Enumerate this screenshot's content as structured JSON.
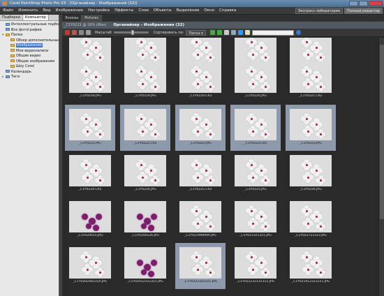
{
  "window": {
    "title": "Corel PaintShop Photo Pro X3 - [Органайзер - Изображения (32)]"
  },
  "menu": [
    "Файл",
    "Изменить",
    "Вид",
    "Изображение",
    "Настройка",
    "Эффекты",
    "Слои",
    "Объекты",
    "Выделение",
    "Окно",
    "Справка"
  ],
  "mode_buttons": [
    "Экспресс-лаборатория",
    "Полный редактор"
  ],
  "left_panel": {
    "tabs": [
      "Подборки",
      "Компьютер"
    ],
    "tree": [
      {
        "label": "Интеллектуальные подборки",
        "expander": "",
        "folder": false
      },
      {
        "label": "Все фотографии",
        "expander": "",
        "folder": false
      },
      {
        "label": "Папки",
        "expander": "▾",
        "folder": true
      },
      {
        "label": "Обзор дополнительных папок",
        "expander": "",
        "folder": true
      },
      {
        "label": "Изображения",
        "expander": "",
        "folder": true,
        "selected": true
      },
      {
        "label": "Мои видеозаписи",
        "expander": "",
        "folder": true
      },
      {
        "label": "Общие видео",
        "expander": "",
        "folder": true
      },
      {
        "label": "Общие изображения",
        "expander": "",
        "folder": true
      },
      {
        "label": "Шоу Corel",
        "expander": "",
        "folder": true
      },
      {
        "label": "Календарь",
        "expander": "",
        "folder": false
      },
      {
        "label": "Теги",
        "expander": "▸",
        "folder": false
      }
    ]
  },
  "file_tabs": [
    "Эскизы",
    "Pictures"
  ],
  "organizer": {
    "file_label": "_C1Y0221 @ 16% (Фон)",
    "title": "Органайзер - Изображения (32)"
  },
  "toolbar": {
    "zoom_label": "Масштаб",
    "zoom_level": 0.55,
    "sort_label": "Сортировать по:",
    "sort_value": "Папка"
  },
  "thumbnails": [
    {
      "caption": "_C1Y0201.JPG",
      "style": "dark",
      "selected": false
    },
    {
      "caption": "_C1Y0216.CR2",
      "style": "dark",
      "selected": false
    },
    {
      "caption": "_C1Y0216.JPG",
      "style": "dark",
      "selected": false
    },
    {
      "caption": "_C1Y0217.CR2",
      "style": "dark",
      "selected": false
    },
    {
      "caption": "_C1Y0217.JPG",
      "style": "dark",
      "selected": false
    },
    {
      "caption": "_C1Y0218.JPG",
      "style": "dark",
      "selected": false
    },
    {
      "caption": "_C1Y0219.JPG",
      "style": "dark",
      "selected": false
    },
    {
      "caption": "_C1Y0220.CR2",
      "style": "dark",
      "selected": false
    },
    {
      "caption": "_C1Y0220.JPG",
      "style": "dark",
      "selected": false
    },
    {
      "caption": "_C1Y0221.CR2",
      "style": "light",
      "selected": false
    },
    {
      "caption": "_C1Y0221.JPG",
      "style": "light",
      "selected": true
    },
    {
      "caption": "_C1Y0222.CR2",
      "style": "light",
      "selected": true
    },
    {
      "caption": "_C1Y0222.JPG",
      "style": "light",
      "selected": true
    },
    {
      "caption": "_C1Y0223.CR2",
      "style": "light",
      "selected": true
    },
    {
      "caption": "_C1Y0223.JPG",
      "style": "light",
      "selected": true
    },
    {
      "caption": "_C1Y0224.CR2",
      "style": "light",
      "selected": false
    },
    {
      "caption": "_C1Y0224.JPG",
      "style": "light",
      "selected": false
    },
    {
      "caption": "_C1Y0225.CR2",
      "style": "light",
      "selected": false
    },
    {
      "caption": "_C1Y0225.JPG",
      "style": "light",
      "selected": false
    },
    {
      "caption": "_C1Y0226.JPG",
      "style": "light",
      "selected": false
    },
    {
      "caption": "_C1Y020015.JPG",
      "style": "purple",
      "selected": false
    },
    {
      "caption": "_C1Y0200126.JPG",
      "style": "purple",
      "selected": false
    },
    {
      "caption": "_C1Y021999999.JPG",
      "style": "dark",
      "selected": false
    },
    {
      "caption": "_C1Y021321321.JPG",
      "style": "dark",
      "selected": false
    },
    {
      "caption": "_C1Y022721323.JPG",
      "style": "dark",
      "selected": false
    },
    {
      "caption": "_C1Y0202442324.JPG",
      "style": "light",
      "selected": false
    },
    {
      "caption": "_C1Y02012312321.JPG",
      "style": "purple",
      "selected": false
    },
    {
      "caption": "_C1Y0222322321.JPG",
      "style": "dark",
      "selected": true
    },
    {
      "caption": "_C1Y021232131312.JPG",
      "style": "dark",
      "selected": false
    },
    {
      "caption": "_C1Y021912323121.JPG",
      "style": "light",
      "selected": false
    }
  ]
}
